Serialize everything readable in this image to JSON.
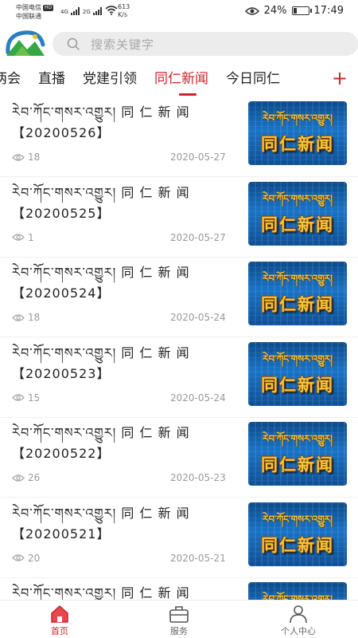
{
  "status_bar": {
    "carrier1": "中国电信",
    "hd": "HD",
    "carrier2": "中国联通",
    "net1": "4G",
    "net2": "2G",
    "speed_value": "613",
    "speed_unit": "K/s",
    "battery": "24%",
    "battery_level": 0.24,
    "time": "17:49"
  },
  "search": {
    "placeholder": "搜索关键字"
  },
  "tabs": [
    {
      "label": "两会"
    },
    {
      "label": "直播"
    },
    {
      "label": "党建引领"
    },
    {
      "label": "同仁新闻",
      "active": true
    },
    {
      "label": "今日同仁"
    }
  ],
  "tab_add": "+",
  "news": [
    {
      "title_tibetan": "རེབ་ཀོང་གསར་འགྱུར།",
      "title_cn": "同 仁 新 闻",
      "title_code": "【20200526】",
      "views": "18",
      "date": "2020-05-27"
    },
    {
      "title_tibetan": "རེབ་ཀོང་གསར་འགྱུར།",
      "title_cn": "同 仁 新 闻",
      "title_code": "【20200525】",
      "views": "1",
      "date": "2020-05-27"
    },
    {
      "title_tibetan": "རེབ་ཀོང་གསར་འགྱུར།",
      "title_cn": "同 仁 新 闻",
      "title_code": "【20200524】",
      "views": "18",
      "date": "2020-05-24"
    },
    {
      "title_tibetan": "རེབ་ཀོང་གསར་འགྱུར།",
      "title_cn": "同 仁 新 闻",
      "title_code": "【20200523】",
      "views": "15",
      "date": "2020-05-24"
    },
    {
      "title_tibetan": "རེབ་ཀོང་གསར་འགྱུར།",
      "title_cn": "同 仁 新 闻",
      "title_code": "【20200522】",
      "views": "26",
      "date": "2020-05-23"
    },
    {
      "title_tibetan": "རེབ་ཀོང་གསར་འགྱུར།",
      "title_cn": "同 仁 新 闻",
      "title_code": "【20200521】",
      "views": "20",
      "date": "2020-05-21"
    },
    {
      "title_tibetan": "རེབ་ཀོང་གསར་འགྱུར།",
      "title_cn": "同 仁 新 闻",
      "title_code": "",
      "views": "",
      "date": ""
    }
  ],
  "thumbnail": {
    "banner_tibetan": "རེབ་ཀོང་གསར་འགྱུར།",
    "banner_cn": "同仁新闻"
  },
  "bottom_nav": [
    {
      "label": "首页",
      "icon": "home-icon",
      "active": true
    },
    {
      "label": "服务",
      "icon": "briefcase-icon"
    },
    {
      "label": "个人中心",
      "icon": "person-icon"
    }
  ],
  "colors": {
    "accent": "#c9252c",
    "muted": "#999999",
    "search_bg": "#ececec"
  }
}
